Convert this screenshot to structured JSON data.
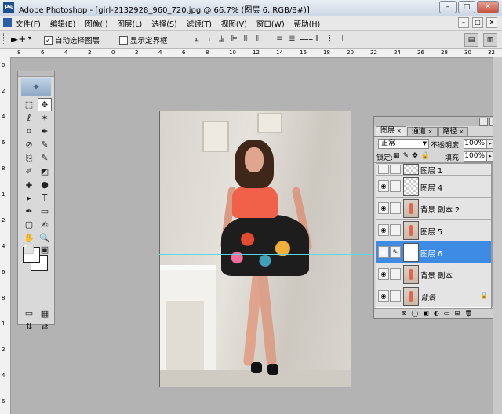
{
  "window": {
    "app_icon": "Ps",
    "title": "Adobe Photoshop - [girl-2132928_960_720.jpg @ 66.7% (图层 6, RGB/8#)]",
    "controls": [
      "–",
      "□",
      "✕"
    ]
  },
  "menu": {
    "items": [
      "文件(F)",
      "编辑(E)",
      "图像(I)",
      "图层(L)",
      "选择(S)",
      "滤镜(T)",
      "视图(V)",
      "窗口(W)",
      "帮助(H)"
    ],
    "doc_controls": [
      "–",
      "□",
      "✕"
    ]
  },
  "options": {
    "move_tool_glyph": "►+",
    "dropdown_glyph": "▾",
    "auto_select_label": "自动选择图层",
    "auto_select_checked": "✓",
    "show_bounds_label": "显示定界框",
    "align_icons": [
      "⫠",
      "⫟",
      "⫡",
      "⊫",
      "⊪",
      "⊩"
    ],
    "distribute_icons": [
      "≡",
      "≣",
      "⩶",
      "⦀",
      "⦙",
      "⦚"
    ]
  },
  "ruler": {
    "top_ticks": [
      "8",
      "6",
      "4",
      "2",
      "0",
      "2",
      "4",
      "6",
      "8",
      "10",
      "12",
      "14",
      "16",
      "18",
      "20",
      "22",
      "24",
      "26",
      "28",
      "30",
      "32"
    ],
    "left_ticks": [
      "0",
      "2",
      "4",
      "6",
      "8",
      "1",
      "2",
      "4",
      "6",
      "8",
      "1",
      "2",
      "4",
      "6"
    ]
  },
  "toolbox": {
    "logo": "✦",
    "tools": [
      "⬚",
      "✥",
      "ℓ",
      "✶",
      "⌗",
      "✒",
      "⊘",
      "✎",
      "⎘",
      "✎",
      "✐",
      "◩",
      "◈",
      "●",
      "▸",
      "T",
      "✒",
      "▭",
      "▢",
      "✍",
      "✋",
      "🔍",
      "⬜",
      "▣",
      "▭",
      "▦",
      "⇅",
      "⇄"
    ]
  },
  "layers_panel": {
    "tabs": [
      "图层",
      "通道",
      "路径"
    ],
    "tab_close": "×",
    "blend_mode": "正常",
    "opacity_label": "不透明度:",
    "opacity_value": "100%",
    "lock_label": "锁定:",
    "lock_icons": [
      "▦",
      "✎",
      "✥",
      "🔒"
    ],
    "fill_label": "填充:",
    "fill_value": "100%",
    "eye_glyph": "◉",
    "brush_glyph": "✎",
    "lock_glyph": "🔒",
    "layers": [
      {
        "name": "图层 1",
        "thumb": "transparent",
        "visible": false
      },
      {
        "name": "图层 4",
        "thumb": "transparent",
        "visible": true
      },
      {
        "name": "背景 副本 2",
        "thumb": "photo",
        "visible": true
      },
      {
        "name": "图层 5",
        "thumb": "photo",
        "visible": true
      },
      {
        "name": "图层 6",
        "thumb": "white",
        "visible": true,
        "selected": true
      },
      {
        "name": "背景 副本",
        "thumb": "photo",
        "visible": true
      },
      {
        "name": "背景",
        "thumb": "photo",
        "visible": true,
        "locked": true
      }
    ],
    "footer_icons": [
      "⊗",
      "◯",
      "▣",
      "◐",
      "▭",
      "⊞",
      "🗑"
    ]
  },
  "colors": {
    "canvas_bg": "#b3b3b3",
    "selection": "#3e8be3",
    "guide": "#59d8e6"
  }
}
